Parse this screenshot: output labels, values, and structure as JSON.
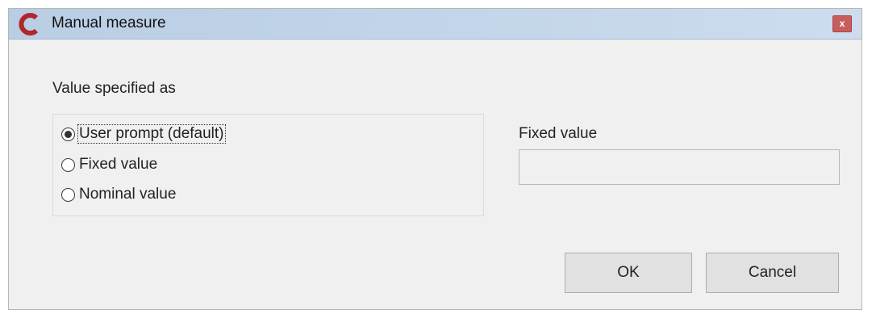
{
  "window": {
    "title": "Manual measure",
    "close_label": "x",
    "app_icon": "c-logo-icon"
  },
  "value_spec": {
    "label": "Value specified as",
    "options": [
      {
        "label": "User prompt (default)",
        "checked": true
      },
      {
        "label": "Fixed value",
        "checked": false
      },
      {
        "label": "Nominal value",
        "checked": false
      }
    ]
  },
  "fixed_value": {
    "label": "Fixed value",
    "value": "",
    "placeholder": ""
  },
  "buttons": {
    "ok_label": "OK",
    "cancel_label": "Cancel"
  },
  "colors": {
    "logo_red": "#b0262b",
    "close_red": "#c85d5d",
    "titlebar_blue": "#c4d6ea",
    "dialog_bg": "#f0f0f0"
  }
}
